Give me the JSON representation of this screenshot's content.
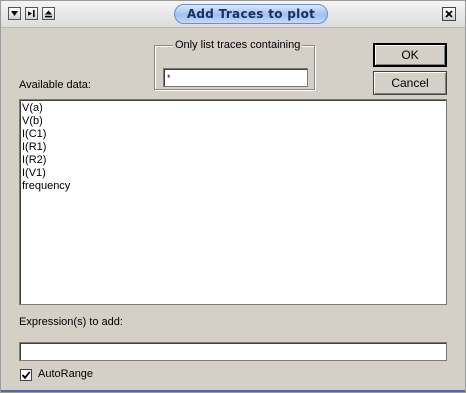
{
  "window": {
    "title": "Add Traces to plot"
  },
  "titlebar_buttons": {
    "menu_icon": "chevron-down-icon",
    "restore_icon": "pin-icon",
    "minimize_icon": "eject-icon",
    "close_icon": "close-icon"
  },
  "filter": {
    "group_label": "Only list traces containing",
    "value": "*"
  },
  "buttons": {
    "ok_label": "OK",
    "cancel_label": "Cancel"
  },
  "available": {
    "label": "Available data:",
    "items": [
      "V(a)",
      "V(b)",
      "I(C1)",
      "I(R1)",
      "I(R2)",
      "I(V1)",
      "frequency"
    ]
  },
  "expression": {
    "label": "Expression(s) to add:",
    "value": ""
  },
  "autorange": {
    "label": "AutoRange",
    "checked": true
  },
  "colors": {
    "dialog_bg": "#d4d0c8",
    "title_pill": "#9fc0f0",
    "title_text": "#1c2f60",
    "field_bg": "#ffffff"
  }
}
